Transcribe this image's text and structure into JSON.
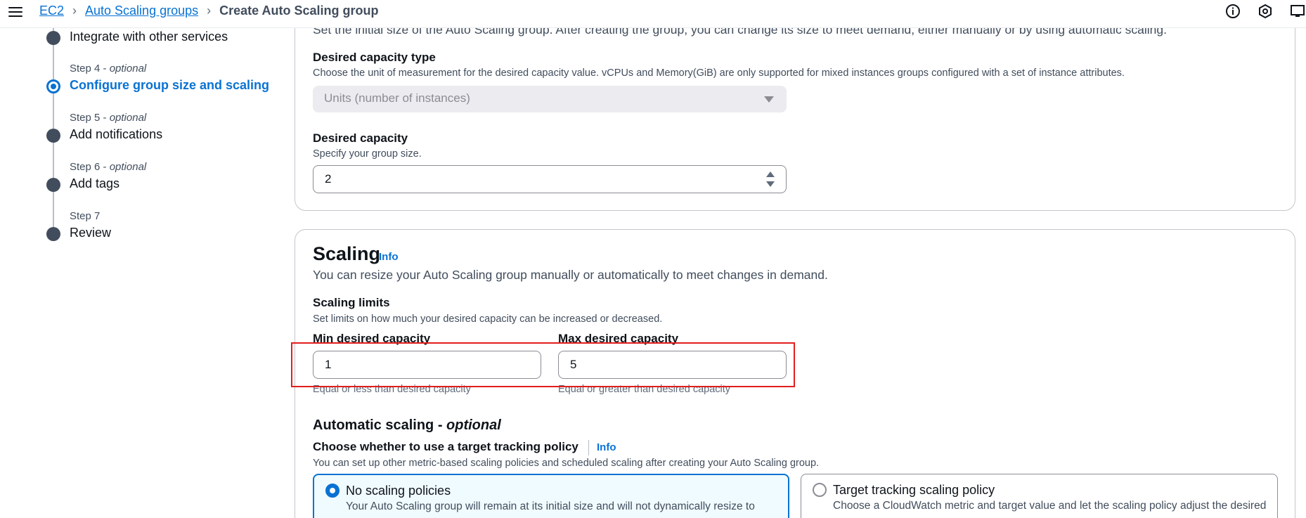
{
  "breadcrumb": {
    "items": [
      "EC2",
      "Auto Scaling groups"
    ],
    "current": "Create Auto Scaling group"
  },
  "top_icons": [
    "info-icon",
    "settings-icon",
    "feedback-icon"
  ],
  "steps": [
    {
      "small": "",
      "title": "Integrate with other services",
      "state": "done"
    },
    {
      "small_step": "Step 4 - ",
      "small_opt": "optional",
      "title": "Configure group size and scaling",
      "state": "active"
    },
    {
      "small_step": "Step 5 - ",
      "small_opt": "optional",
      "title": "Add notifications",
      "state": "pending"
    },
    {
      "small_step": "Step 6 - ",
      "small_opt": "optional",
      "title": "Add tags",
      "state": "pending"
    },
    {
      "small_step": "Step 7",
      "small_opt": "",
      "title": "Review",
      "state": "pending"
    }
  ],
  "group_size": {
    "intro": "Set the initial size of the Auto Scaling group. After creating the group, you can change its size to meet demand, either manually or by using automatic scaling.",
    "desired_capacity_type": {
      "label": "Desired capacity type",
      "description": "Choose the unit of measurement for the desired capacity value. vCPUs and Memory(GiB) are only supported for mixed instances groups configured with a set of instance attributes.",
      "value": "Units (number of instances)"
    },
    "desired_capacity": {
      "label": "Desired capacity",
      "description": "Specify your group size.",
      "value": "2"
    }
  },
  "scaling": {
    "title": "Scaling",
    "info": "Info",
    "description": "You can resize your Auto Scaling group manually or automatically to meet changes in demand.",
    "limits": {
      "label": "Scaling limits",
      "description": "Set limits on how much your desired capacity can be increased or decreased.",
      "min": {
        "label": "Min desired capacity",
        "value": "1",
        "hint": "Equal or less than desired capacity"
      },
      "max": {
        "label": "Max desired capacity",
        "value": "5",
        "hint": "Equal or greater than desired capacity"
      }
    },
    "automatic": {
      "title": "Automatic scaling - ",
      "title_opt": "optional",
      "question": "Choose whether to use a target tracking policy",
      "info": "Info",
      "description": "You can set up other metric-based scaling policies and scheduled scaling after creating your Auto Scaling group.",
      "options": [
        {
          "title": "No scaling policies",
          "description": "Your Auto Scaling group will remain at its initial size and will not dynamically resize to",
          "selected": true
        },
        {
          "title": "Target tracking scaling policy",
          "description": "Choose a CloudWatch metric and target value and let the scaling policy adjust the desired",
          "selected": false
        }
      ]
    }
  },
  "colors": {
    "accent": "#0972d3",
    "highlight": "#e21d1d"
  }
}
